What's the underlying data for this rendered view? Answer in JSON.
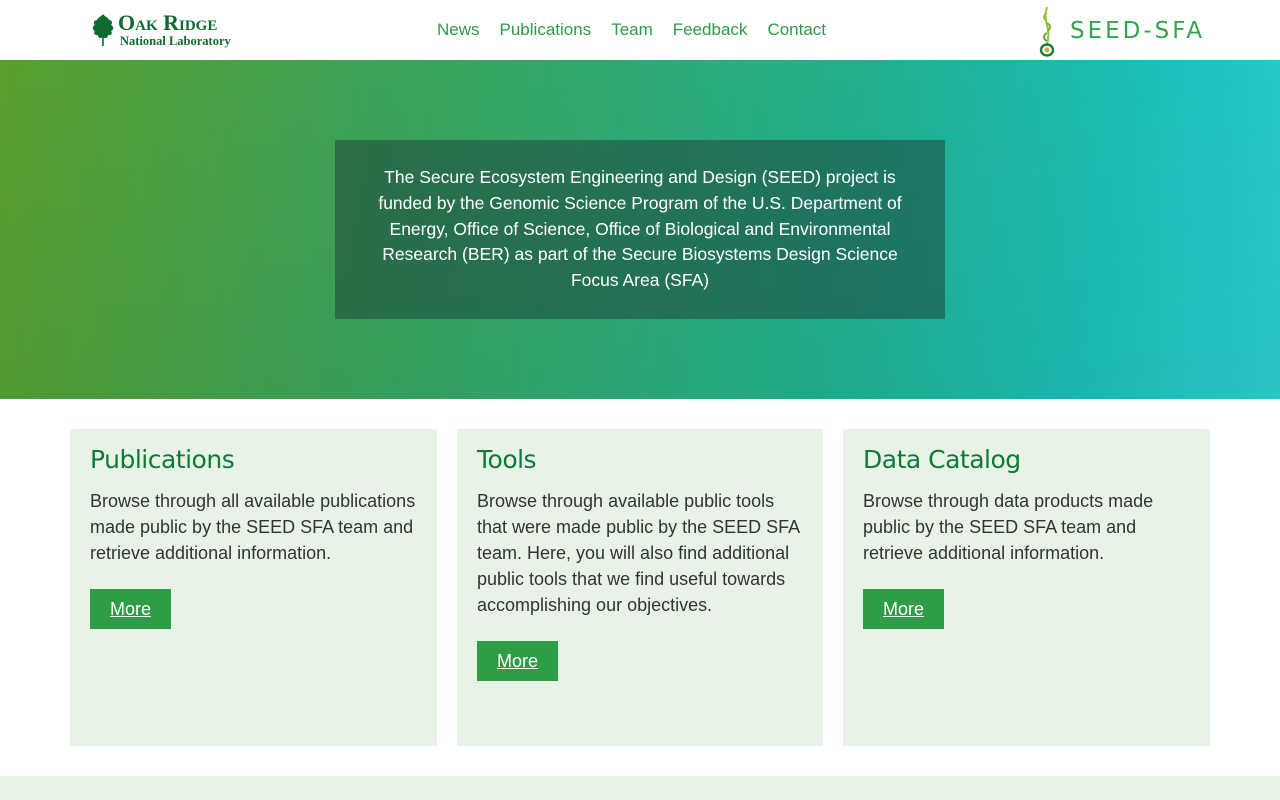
{
  "header": {
    "ornl_logo": {
      "line1": "Oak Ridge",
      "line2": "National Laboratory",
      "icon": "oak-leaf-icon"
    },
    "nav": [
      {
        "label": "News"
      },
      {
        "label": "Publications"
      },
      {
        "label": "Team"
      },
      {
        "label": "Feedback"
      },
      {
        "label": "Contact"
      }
    ],
    "seed_logo": {
      "text": "SEED-SFA",
      "icon": "seedling-icon"
    }
  },
  "hero": {
    "text": "The Secure Ecosystem Engineering and Design (SEED) project is funded by the Genomic Science Program of the U.S. Department of Energy, Office of Science, Office of Biological and Environmental Research (BER) as part of the Secure Biosystems Design Science Focus Area (SFA)"
  },
  "cards": [
    {
      "title": "Publications",
      "text": "Browse through all available publications made public by the SEED SFA team and retrieve additional information.",
      "button": "More"
    },
    {
      "title": "Tools",
      "text": "Browse through available public tools that were made public by the SEED SFA team. Here, you will also find additional public tools that we find useful towards accomplishing our objectives.",
      "button": "More"
    },
    {
      "title": "Data Catalog",
      "text": "Browse through data products made public by the SEED SFA team and retrieve additional information.",
      "button": "More"
    }
  ],
  "colors": {
    "brand_green": "#2f9c46",
    "title_green": "#0f7a36",
    "card_bg": "#e8f3e8"
  }
}
